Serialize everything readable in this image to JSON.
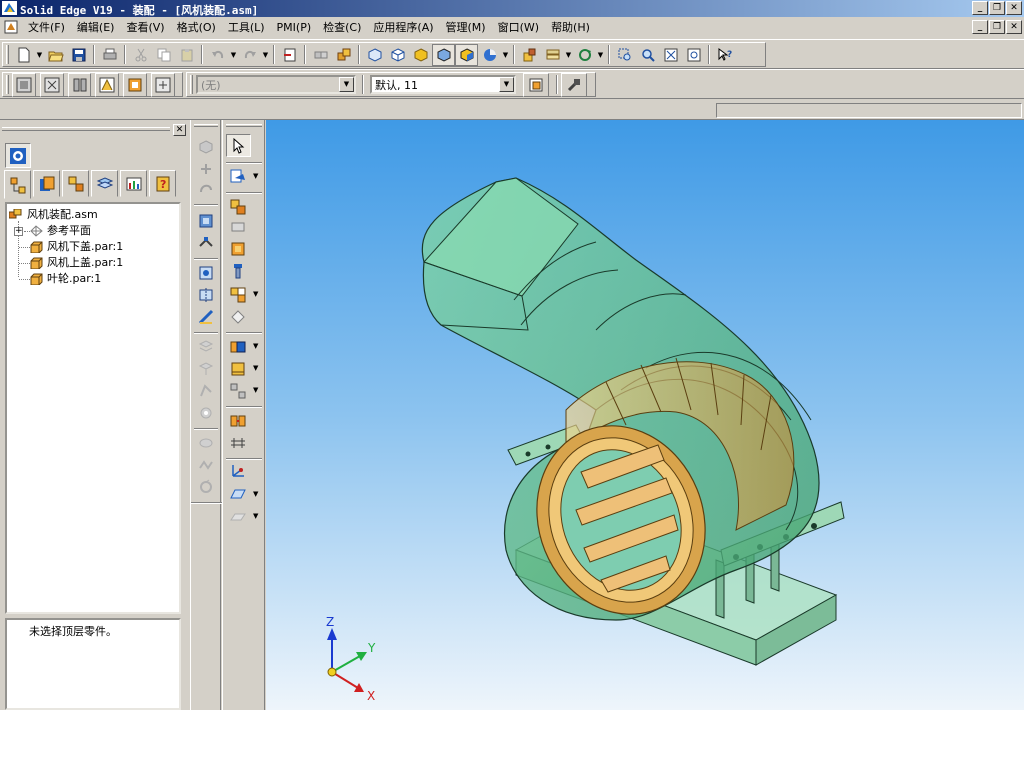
{
  "window": {
    "title": "Solid Edge V19 - 装配 - [风机装配.asm]",
    "buttons": {
      "minimize": "_",
      "restore": "❐",
      "close": "✕"
    }
  },
  "menu": {
    "items": [
      "文件(F)",
      "编辑(E)",
      "查看(V)",
      "格式(O)",
      "工具(L)",
      "PMI(P)",
      "检查(C)",
      "应用程序(A)",
      "管理(M)",
      "窗口(W)",
      "帮助(H)"
    ]
  },
  "toolbar2": {
    "layer_combo": "(无)",
    "style_combo": "默认, 11"
  },
  "pathfinder": {
    "close_label": "✕",
    "tree": {
      "root": "风机装配.asm",
      "items": [
        {
          "label": "参考平面",
          "type": "reference-planes"
        },
        {
          "label": "风机下盖.par:1",
          "type": "part"
        },
        {
          "label": "风机上盖.par:1",
          "type": "part"
        },
        {
          "label": "叶轮.par:1",
          "type": "part"
        }
      ]
    },
    "message": "未选择顶层零件。"
  },
  "triad": {
    "z": "Z",
    "y": "Y",
    "x": "X"
  },
  "colors": {
    "title_start": "#0a246a",
    "title_end": "#a6caf0",
    "chrome": "#d4d0c8",
    "viewport_top": "#3f9ae6",
    "housing_green": "#5fc08a",
    "impeller_gold": "#e3b35c"
  }
}
